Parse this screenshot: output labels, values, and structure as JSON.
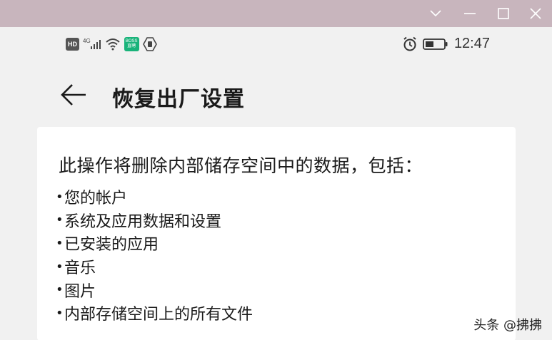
{
  "window": {
    "controls": [
      "chevron-down",
      "minimize",
      "maximize",
      "close"
    ]
  },
  "statusbar": {
    "hd": "HD",
    "network": "4G",
    "boss": "BOSS 直聘",
    "time": "12:47"
  },
  "header": {
    "title": "恢复出厂设置"
  },
  "card": {
    "intro": "此操作将删除内部储存空间中的数据，包括：",
    "bullet": "•",
    "items": [
      "您的帐户",
      "系统及应用数据和设置",
      "已安装的应用",
      "音乐",
      "图片",
      "内部存储空间上的所有文件"
    ]
  },
  "watermark": "头条 @拂拂"
}
